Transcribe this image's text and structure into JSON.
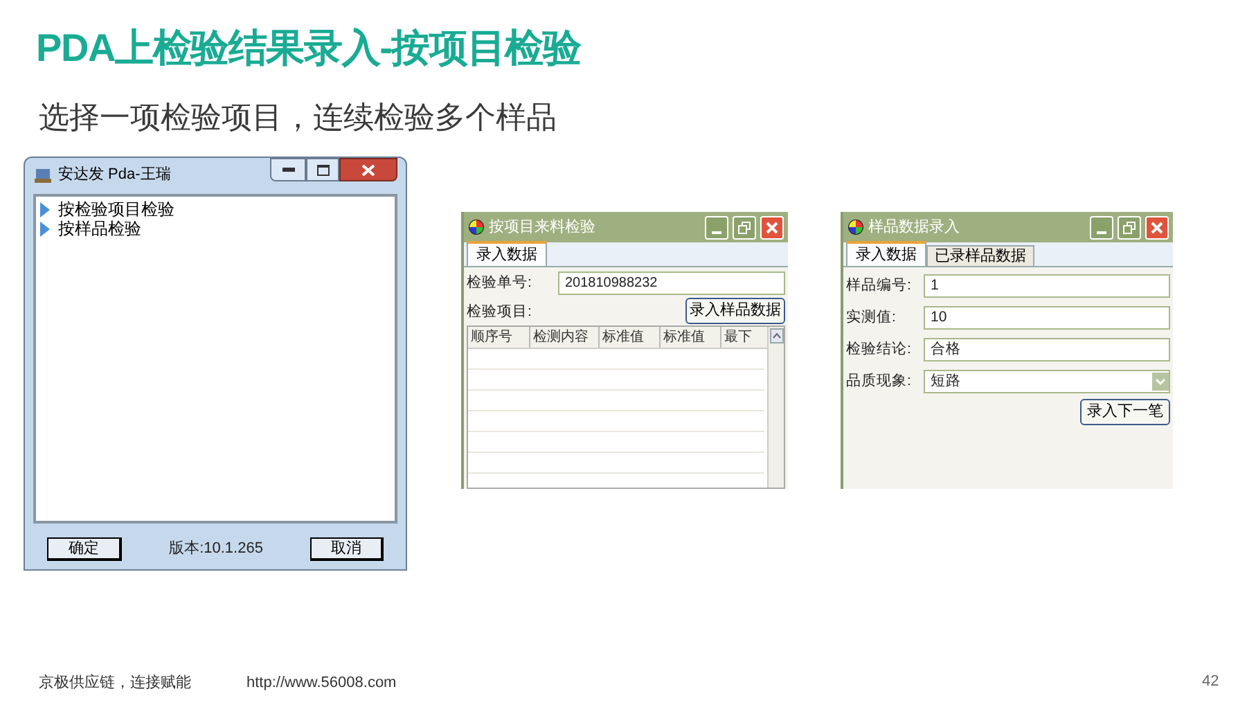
{
  "title": "PDA上检验结果录入-按项目检验",
  "subtitle": "选择一项检验项目，连续检验多个样品",
  "menu_window": {
    "title": "安达发 Pda-王瑞",
    "items": [
      {
        "label": "按检验项目检验"
      },
      {
        "label": "按样品检验"
      }
    ],
    "ok_button": "确定",
    "version": "版本:10.1.265",
    "cancel_button": "取消"
  },
  "item_window": {
    "title": "按项目来料检验",
    "tabs": [
      {
        "label": "录入数据",
        "selected": true
      }
    ],
    "fields": [
      {
        "label": "检验单号:",
        "value": "201810988232"
      }
    ],
    "item_label": "检验项目:",
    "button": "录入样品数据",
    "columns": [
      "顺序号",
      "检测内容",
      "标准值",
      "标准值",
      "最下"
    ]
  },
  "sample_window": {
    "title": "样品数据录入",
    "tabs": [
      {
        "label": "录入数据",
        "selected": true
      },
      {
        "label": "已录样品数据",
        "selected": false
      }
    ],
    "fields": [
      {
        "label": "样品编号:",
        "value": "1",
        "kind": "text"
      },
      {
        "label": "实测值:",
        "value": "10",
        "kind": "text"
      },
      {
        "label": "检验结论:",
        "value": "合格",
        "kind": "text"
      },
      {
        "label": "品质现象:",
        "value": "短路",
        "kind": "dropdown"
      }
    ],
    "button": "录入下一笔"
  },
  "footer": {
    "slogan": "京极供应链，连接赋能",
    "url": "http://www.56008.com",
    "page_number": "42"
  }
}
